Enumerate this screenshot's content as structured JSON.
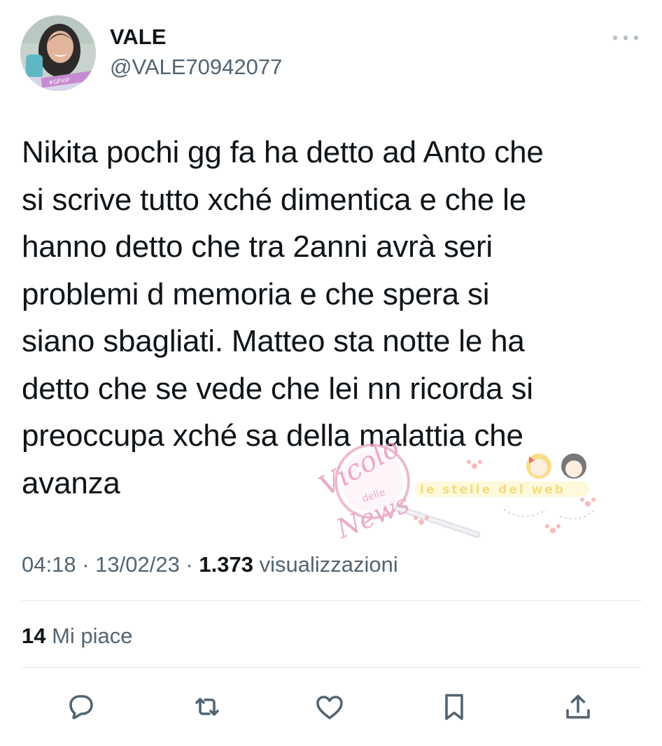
{
  "tweet": {
    "author": {
      "display_name": "VALE",
      "handle": "@VALE70942077",
      "avatar_caption": "#GFVIP"
    },
    "text": "Nikita pochi gg fa ha detto ad Anto che\nsi scrive tutto xché dimentica e che le\nhanno detto che tra 2anni avrà seri\nproblemi d memoria e che spera si\nsiano sbagliati. Matteo sta notte le ha\ndetto che se vede che lei nn ricorda si\npreoccupa xché sa della malattia che\navanza",
    "time": "04:18",
    "separator": "·",
    "date": "13/02/23",
    "views_count": "1.373",
    "views_label": "visualizzazioni",
    "likes_count": "14",
    "likes_label": "Mi piace"
  },
  "watermark": {
    "line1": "Vicolo",
    "line2": "delle",
    "line3": "News",
    "banner": "le stelle del web"
  },
  "actions": [
    {
      "name": "reply",
      "icon": "reply-bubble-icon"
    },
    {
      "name": "retweet",
      "icon": "retweet-arrows-icon"
    },
    {
      "name": "like",
      "icon": "heart-icon"
    },
    {
      "name": "bookmark",
      "icon": "bookmark-icon"
    },
    {
      "name": "share",
      "icon": "share-upload-icon"
    }
  ],
  "colors": {
    "text_primary": "#0f1419",
    "text_secondary": "#536471",
    "divider": "#e4e8eb",
    "watermark_pink": "#e9a3c4"
  }
}
